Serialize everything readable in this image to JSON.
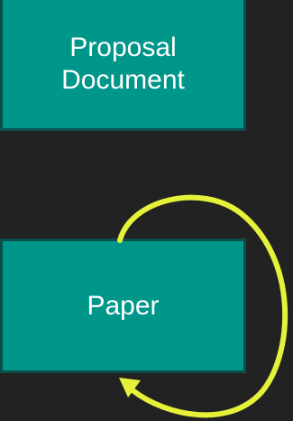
{
  "diagram": {
    "nodes": [
      {
        "id": "proposal",
        "label": "Proposal\nDocument"
      },
      {
        "id": "paper",
        "label": "Paper"
      }
    ],
    "edges": [
      {
        "from": "paper",
        "to": "paper",
        "type": "self-loop"
      }
    ],
    "colors": {
      "background": "#222222",
      "node_fill": "#00968a",
      "node_border": "#0a4f49",
      "node_text": "#ffffff",
      "arrow": "#e6f23a"
    }
  }
}
